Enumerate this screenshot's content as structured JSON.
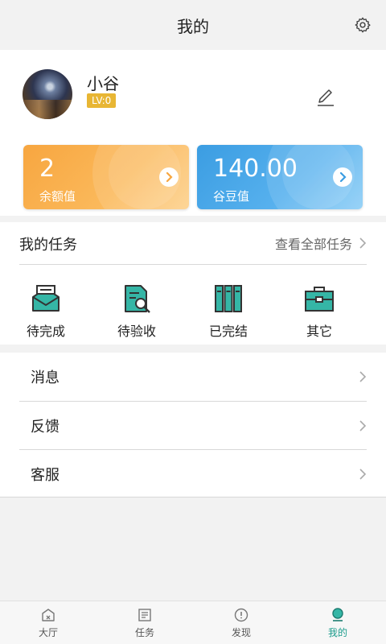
{
  "header": {
    "title": "我的",
    "settings_icon": "gear-icon"
  },
  "profile": {
    "username": "小谷",
    "level": "LV:0",
    "edit_icon": "pencil-icon"
  },
  "cards": [
    {
      "value": "2",
      "label": "余额值",
      "color": "#f7a640"
    },
    {
      "value": "140.00",
      "label": "谷豆值",
      "color": "#3b9de2"
    }
  ],
  "tasks": {
    "title": "我的任务",
    "view_all": "查看全部任务",
    "items": [
      {
        "label": "待完成",
        "icon": "inbox-document-icon"
      },
      {
        "label": "待验收",
        "icon": "document-search-icon"
      },
      {
        "label": "已完结",
        "icon": "binders-icon"
      },
      {
        "label": "其它",
        "icon": "toolbox-icon"
      }
    ]
  },
  "menu": [
    {
      "label": "消息"
    },
    {
      "label": "反馈"
    },
    {
      "label": "客服"
    }
  ],
  "tabbar": {
    "active_color": "#1c9c8c",
    "items": [
      {
        "label": "大厅",
        "icon": "hall-icon"
      },
      {
        "label": "任务",
        "icon": "task-list-icon"
      },
      {
        "label": "发现",
        "icon": "compass-icon"
      },
      {
        "label": "我的",
        "icon": "profile-icon"
      }
    ]
  }
}
